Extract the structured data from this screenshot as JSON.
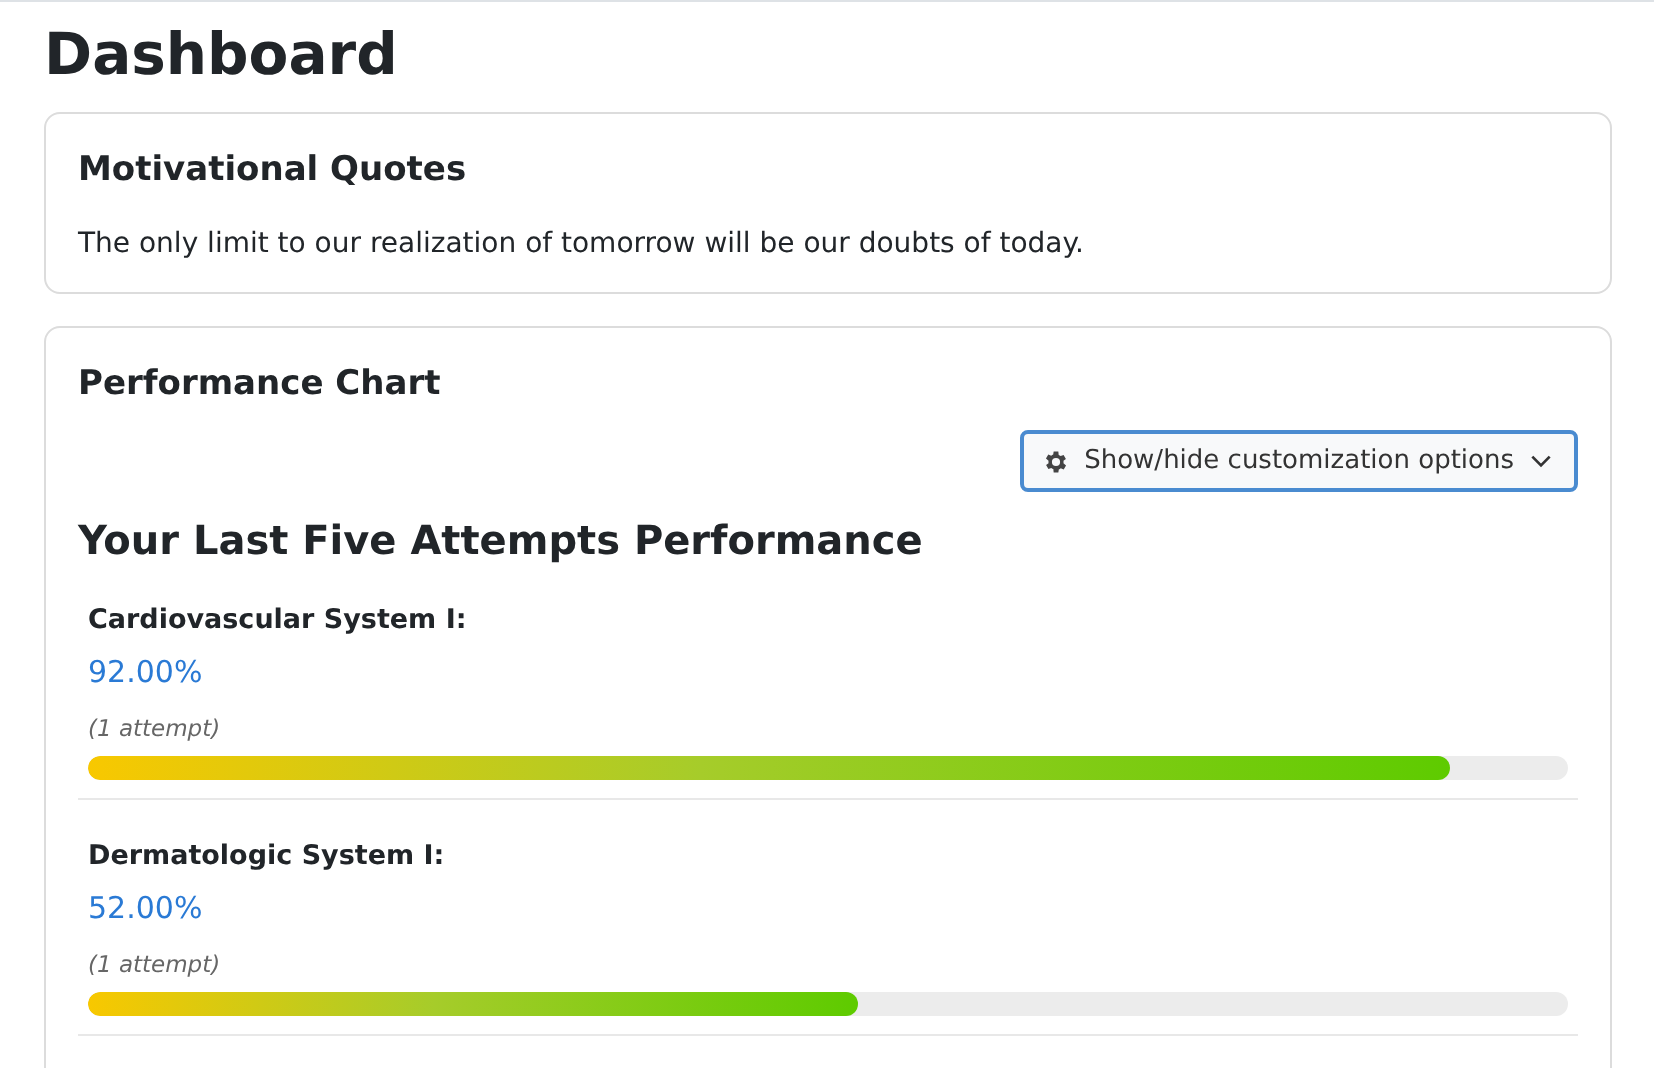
{
  "title": "Dashboard",
  "quotes": {
    "heading": "Motivational Quotes",
    "text": "The only limit to our realization of tomorrow will be our doubts of today."
  },
  "performance": {
    "heading": "Performance Chart",
    "toggle": "Show/hide customization options",
    "subheading": "Your Last Five Attempts Performance",
    "items": [
      {
        "name": "Cardiovascular System I:",
        "score": "92.00%",
        "attempts": "(1 attempt)",
        "level": 0.92
      },
      {
        "name": "Dermatologic System I:",
        "score": "52.00%",
        "attempts": "(1 attempt)",
        "level": 0.52
      }
    ]
  }
}
